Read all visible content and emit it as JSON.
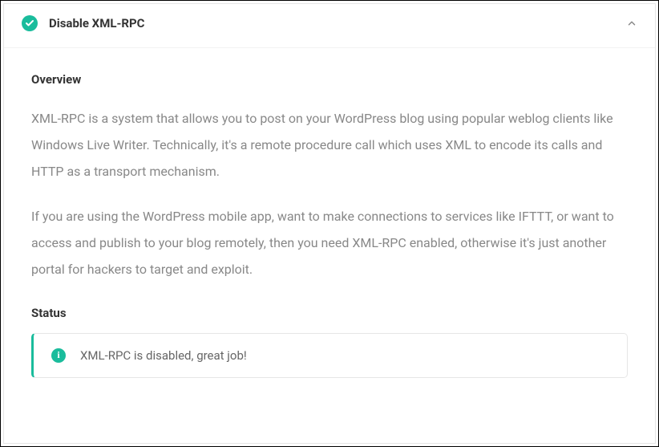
{
  "panel": {
    "title": "Disable XML-RPC",
    "expanded": true
  },
  "overview": {
    "heading": "Overview",
    "paragraph1": "XML-RPC is a system that allows you to post on your WordPress blog using popular weblog clients like Windows Live Writer. Technically, it's a remote procedure call which uses XML to encode its calls and HTTP as a transport mechanism.",
    "paragraph2": "If you are using the WordPress mobile app, want to make connections to services like IFTTT, or want to access and publish to your blog remotely, then you need XML-RPC enabled, otherwise it's just another portal for hackers to target and exploit."
  },
  "status": {
    "heading": "Status",
    "message": "XML-RPC is disabled, great job!"
  },
  "colors": {
    "accent": "#1abc9c"
  }
}
